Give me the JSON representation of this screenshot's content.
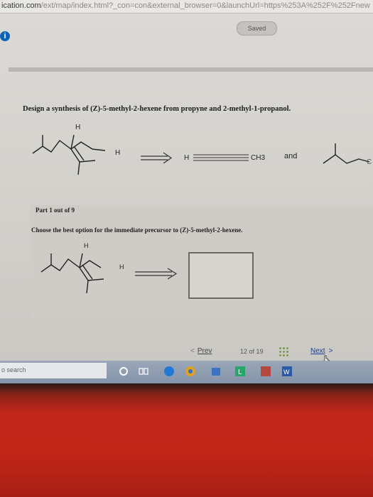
{
  "browser": {
    "url_main": "ication.com",
    "url_path": "/ext/map/index.html?_con=con&external_browser=0&launchUrl=https%253A%252F%252Fnew"
  },
  "header": {
    "saved_label": "Saved",
    "info_icon": "i"
  },
  "question": {
    "text": "Design a synthesis of (Z)-5-methyl-2-hexene from propyne and 2-methyl-1-propanol.",
    "scheme": {
      "h_top": "H",
      "h_right": "H",
      "alkyne_h": "H",
      "alkyne_ch3": "CH3",
      "and_label": "and",
      "fragment_tail": "C"
    }
  },
  "part": {
    "label": "Part 1 out of 9",
    "prompt": "Choose the best option for the immediate precursor to (Z)-5-methyl-2-hexene.",
    "h_top": "H",
    "h_right": "H"
  },
  "navigation": {
    "prev_label": "Prev",
    "counter": "12 of 19",
    "next_label": "Next"
  },
  "taskbar": {
    "search_placeholder": "o search"
  },
  "colors": {
    "accent_blue": "#0a63b6",
    "next_link": "#1d3f8f",
    "laptop_red": "#c0261a"
  }
}
